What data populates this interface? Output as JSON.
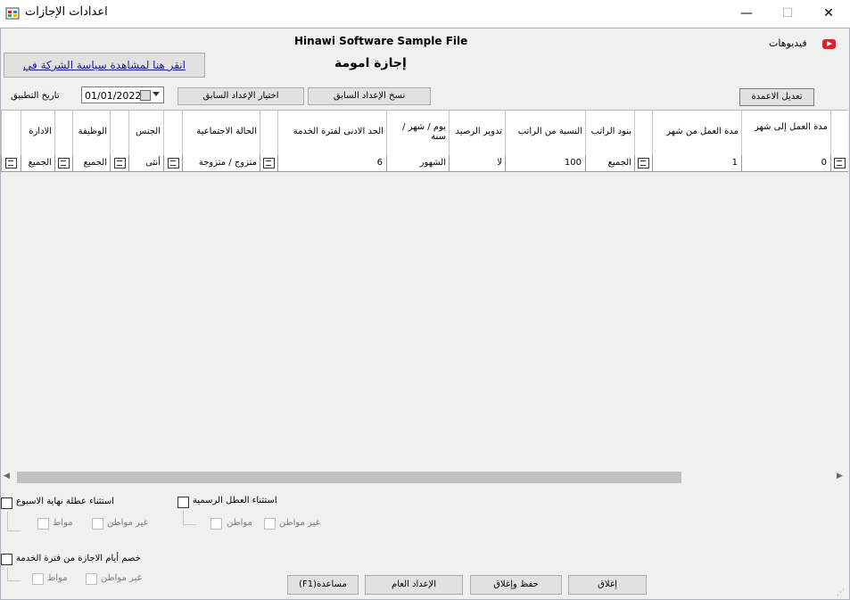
{
  "window": {
    "title": "اعدادات الإجازات",
    "minimize": "—",
    "maximize": "☐",
    "close": "✕"
  },
  "header": {
    "sample_title": "Hinawi Software Sample File",
    "form_title": "إجازة امومة",
    "videos_label": "فيديوهات",
    "policy_link": "انقر هنا لمشاهدة سياسة الشركة في"
  },
  "toolbar": {
    "apply_date_label": "تاريخ التطبيق",
    "apply_date_value": "01/01/2022",
    "choose_previous": "اختيار الإعداد السابق",
    "copy_previous": "نسخ الإعداد السابق",
    "edit_columns": "تعديل الاعمدة"
  },
  "grid": {
    "columns": [
      "مدة العمل إلى شهر",
      "مدة العمل من شهر",
      "بنود الراتب",
      "النسبة من الراتب",
      "تدوير الرصيد",
      "يوم / شهر / سنة",
      "الحد الادنى لفترة الخدمة",
      "الحالة الاجتماعية",
      "الجنس",
      "الوظيفة",
      "الادارة"
    ],
    "row": {
      "work_to_month": "0",
      "work_from_month": "1",
      "salary_items": "الجميع",
      "salary_percent": "100",
      "carry_balance": "لا",
      "period_unit": "الشهور",
      "min_service": "6",
      "marital_status": "متزوج / متزوجة",
      "gender": "أنثى",
      "job": "الجميع",
      "department": "الجميع"
    }
  },
  "options": {
    "exclude_weekend": "استثناء عطلة نهاية الاسبوع",
    "exclude_holidays": "استثناء العطل الرسمية",
    "deduct_days": "خصم أيام الاجازة من فترة الخدمة",
    "citizen": "مواط",
    "non_citizen": "غير مواطن",
    "citizen_full": "مواطن",
    "non_citizen_full": "غير مواطن"
  },
  "buttons": {
    "close": "إغلاق",
    "save_close": "حفظ وإغلاق",
    "general_setup": "الإعداد العام",
    "help": "(F1)مساعدة"
  }
}
